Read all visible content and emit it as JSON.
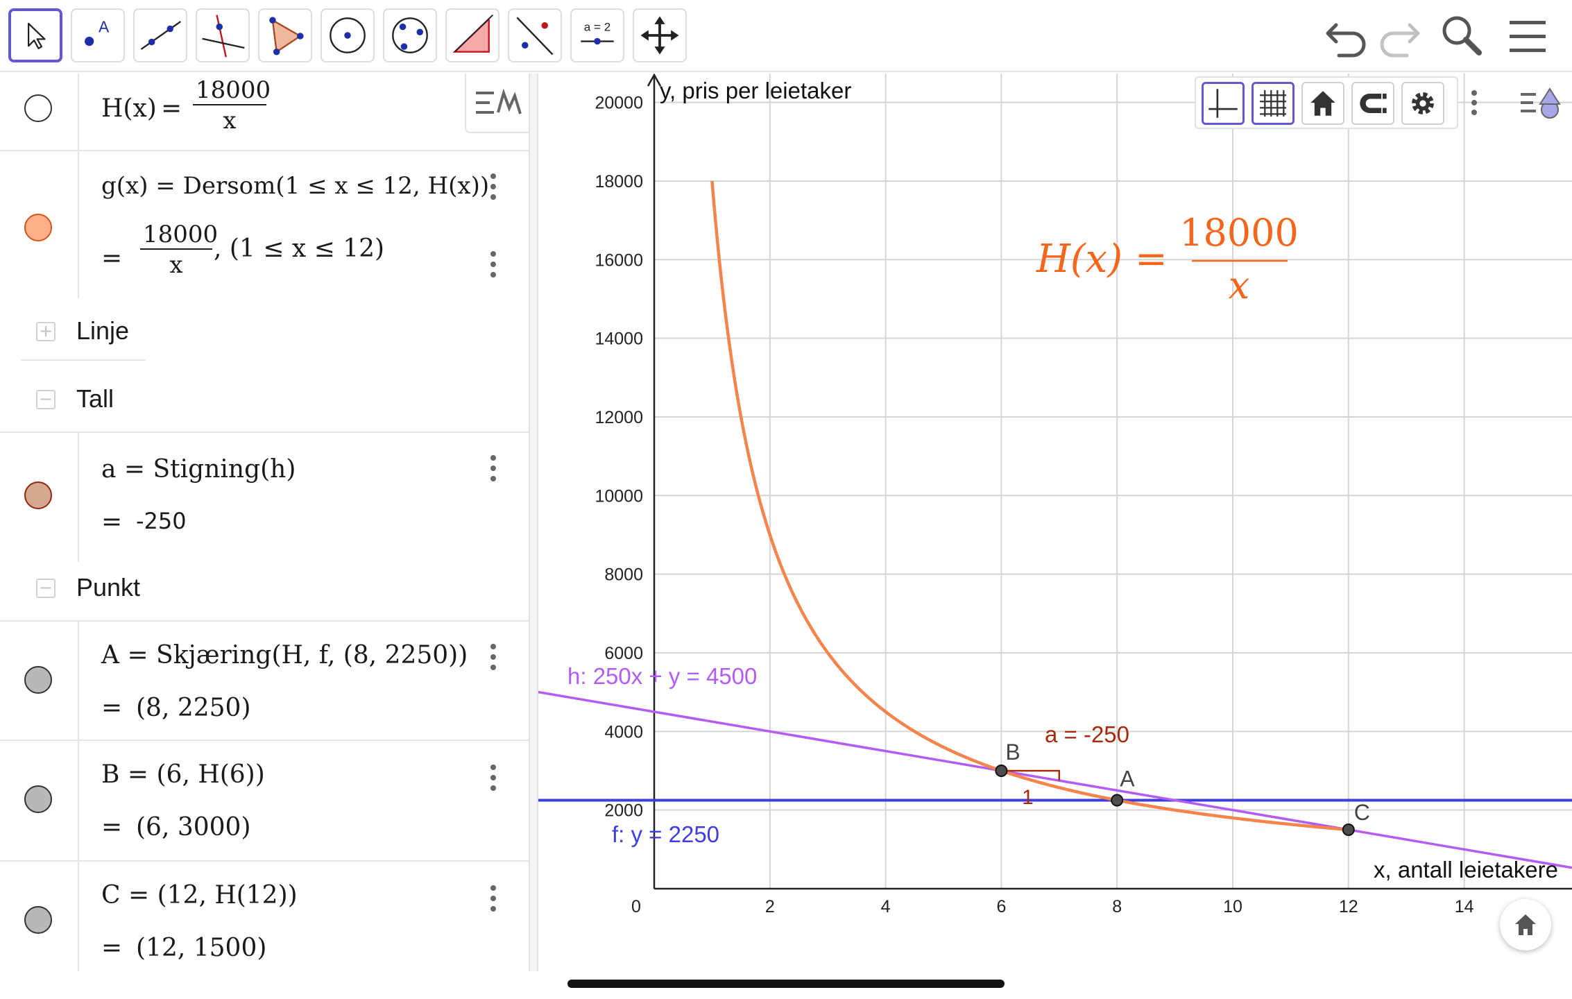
{
  "toolbar": {
    "tools": [
      "move-tool",
      "point-tool",
      "line-tool",
      "perpendicular-line-tool",
      "polygon-tool",
      "circle-center-point-tool",
      "circle-three-points-tool",
      "angle-tool",
      "reflect-tool",
      "slider-tool",
      "move-graphics-view-tool"
    ],
    "slider_label": "a = 2"
  },
  "algebra": {
    "h_def": {
      "lhs": "H(x)",
      "num": "18000",
      "den": "x"
    },
    "g_def": {
      "line1": "g(x)  =  Dersom(1 ≤ x ≤ 12, H(x))",
      "num": "18000",
      "den": "x",
      "cond": ",    (1 ≤ x ≤ 12)"
    },
    "group_linje": "Linje",
    "group_tall": "Tall",
    "a_def": {
      "line1": "a  =  Stigning(h)",
      "line2": "-250"
    },
    "group_punkt": "Punkt",
    "A_def": {
      "line1": "A  =  Skjæring(H, f, (8,  2250))",
      "line2": "(8, 2250)"
    },
    "B_def": {
      "line1": "B  =  (6,  H(6))",
      "line2": "(6, 3000)"
    },
    "C_def": {
      "line1": "C  =  (12,  H(12))",
      "line2": "(12, 1500)"
    },
    "eq": "=",
    "colors": {
      "h_marble": "#ffffff",
      "g_marble": "#ffb088",
      "a_marble": "#d6a78f",
      "point_marble": "#b8b8b8"
    }
  },
  "graphics": {
    "x_axis_label": "x, antall leietakere",
    "y_axis_label": "y, pris per leietaker",
    "x_ticks": [
      "0",
      "2",
      "4",
      "6",
      "8",
      "10",
      "12",
      "14"
    ],
    "y_ticks": [
      "2000",
      "4000",
      "6000",
      "8000",
      "10000",
      "12000",
      "14000",
      "16000",
      "18000",
      "20000"
    ],
    "formula_lhs": "H(x)  =",
    "formula_num": "18000",
    "formula_den": "x",
    "line_h_label": "h: 250x + y = 4500",
    "line_f_label": "f: y = 2250",
    "slope_label": "a = -250",
    "slope_run": "1",
    "point_A": "A",
    "point_B": "B",
    "point_C": "C",
    "colors": {
      "curve": "#f4844c",
      "line_h": "#b25cf5",
      "line_f": "#3d3de0",
      "slope": "#a52a0c",
      "grid": "#d4d4d4",
      "formula": "#f4661c"
    }
  },
  "chart_data": {
    "type": "line",
    "title": "",
    "xlabel": "x, antall leietakere",
    "ylabel": "y, pris per leietaker",
    "xlim": [
      0,
      15.3
    ],
    "ylim": [
      0,
      20400
    ],
    "series": [
      {
        "name": "H(x) = 18000/x",
        "function": "18000/x",
        "domain": [
          1,
          12
        ]
      },
      {
        "name": "h: 250x + y = 4500",
        "function": "4500 - 250*x",
        "domain": [
          -2,
          15.5
        ]
      },
      {
        "name": "f: y = 2250",
        "function": "2250",
        "domain": [
          -2,
          15.5
        ]
      }
    ],
    "points": [
      {
        "name": "A",
        "x": 8,
        "y": 2250
      },
      {
        "name": "B",
        "x": 6,
        "y": 3000
      },
      {
        "name": "C",
        "x": 12,
        "y": 1500
      }
    ],
    "slope": {
      "label": "a = -250",
      "run": 1
    },
    "grid": true
  }
}
